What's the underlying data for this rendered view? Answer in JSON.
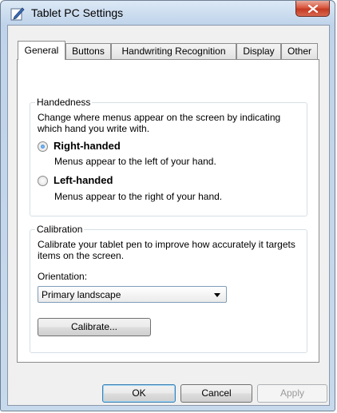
{
  "window": {
    "title": "Tablet PC Settings"
  },
  "tabs": [
    {
      "label": "General"
    },
    {
      "label": "Buttons"
    },
    {
      "label": "Handwriting Recognition"
    },
    {
      "label": "Display"
    },
    {
      "label": "Other"
    }
  ],
  "handedness": {
    "title": "Handedness",
    "description": "Change where menus appear on the screen by indicating which hand you write with.",
    "options": [
      {
        "label": "Right-handed",
        "sub": "Menus appear to the left of your hand.",
        "checked": true
      },
      {
        "label": "Left-handed",
        "sub": "Menus appear to the right of your hand.",
        "checked": false
      }
    ]
  },
  "calibration": {
    "title": "Calibration",
    "description": "Calibrate your tablet pen to improve how accurately it targets items on the screen.",
    "orientation_label": "Orientation:",
    "orientation_value": "Primary landscape",
    "calibrate_label": "Calibrate..."
  },
  "footer": {
    "ok_label": "OK",
    "cancel_label": "Cancel",
    "apply_label": "Apply"
  },
  "icons": {
    "title_icon": "tablet-pen-icon",
    "close_icon": "close-icon",
    "dropdown_icon": "chevron-down-icon"
  },
  "colors": {
    "close_button": "#c43a22",
    "radio_checked": "#1f69c4"
  }
}
